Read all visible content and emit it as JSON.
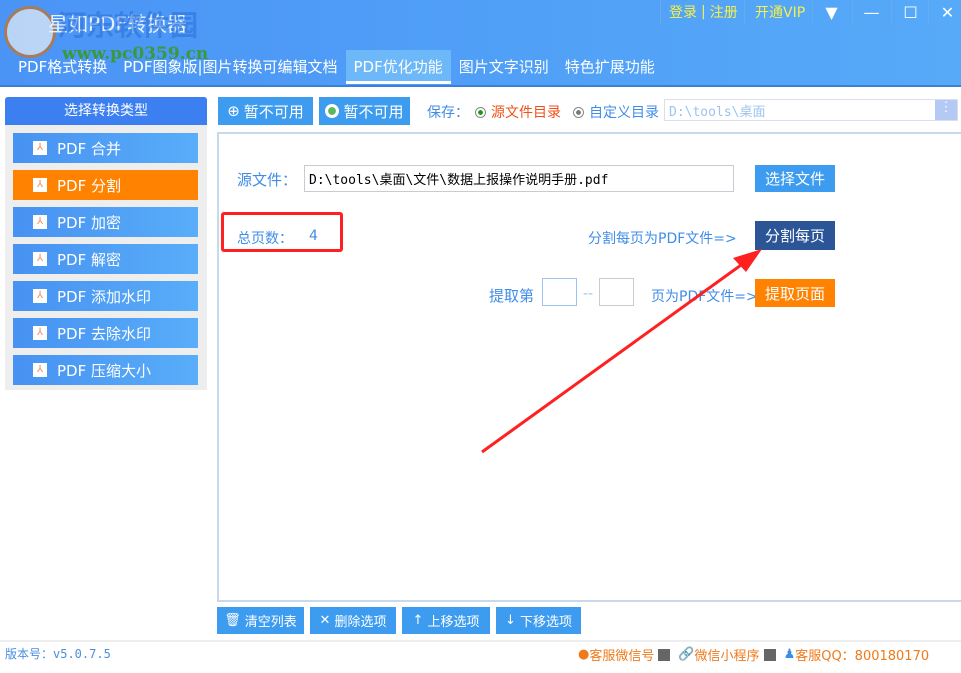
{
  "app": {
    "title": "星如PDF转换器",
    "watermark_name": "河东软件园",
    "watermark_url": "www.pc0359.cn"
  },
  "topbar": {
    "login": "登录",
    "sep": "|",
    "register": "注册",
    "vip": "开通VIP",
    "menu_icon": "▼",
    "minimize": "—",
    "maximize": "☐",
    "close": "✕"
  },
  "tabs": [
    {
      "label": "PDF格式转换"
    },
    {
      "label": "PDF图象版|图片转换可编辑文档"
    },
    {
      "label": "PDF优化功能"
    },
    {
      "label": "图片文字识别"
    },
    {
      "label": "特色扩展功能"
    }
  ],
  "sidebar": {
    "header": "选择转换类型",
    "items": [
      {
        "label": "PDF 合并"
      },
      {
        "label": "PDF 分割"
      },
      {
        "label": "PDF 加密"
      },
      {
        "label": "PDF 解密"
      },
      {
        "label": "PDF 添加水印"
      },
      {
        "label": "PDF 去除水印"
      },
      {
        "label": "PDF 压缩大小"
      }
    ]
  },
  "toolbar": {
    "btn1": "暂不可用",
    "btn2": "暂不可用",
    "save_label": "保存：",
    "opt_source": "源文件目录",
    "opt_custom": "自定义目录",
    "path": "D:\\tools\\桌面"
  },
  "main": {
    "source_label": "源文件：",
    "source_path": "D:\\tools\\桌面\\文件\\数据上报操作说明手册.pdf",
    "choose_file": "选择文件",
    "total_label": "总页数：",
    "total_value": "4",
    "split_label": "分割每页为PDF文件=>",
    "split_btn": "分割每页",
    "extract_label": "提取第",
    "range_sep": "--",
    "extract_suffix": "页为PDF文件=>",
    "extract_btn": "提取页面"
  },
  "bottom": {
    "clear": "清空列表",
    "delete": "删除选项",
    "up": "上移选项",
    "down": "下移选项"
  },
  "status": {
    "version": "版本号：v5.0.7.5",
    "wechat": "客服微信号",
    "miniapp": "微信小程序",
    "qq": "客服QQ：800180170"
  },
  "colors": {
    "accent": "#3d9cf0",
    "active": "#ff8200",
    "dark": "#2c5597",
    "annotation": "#ff2020"
  }
}
